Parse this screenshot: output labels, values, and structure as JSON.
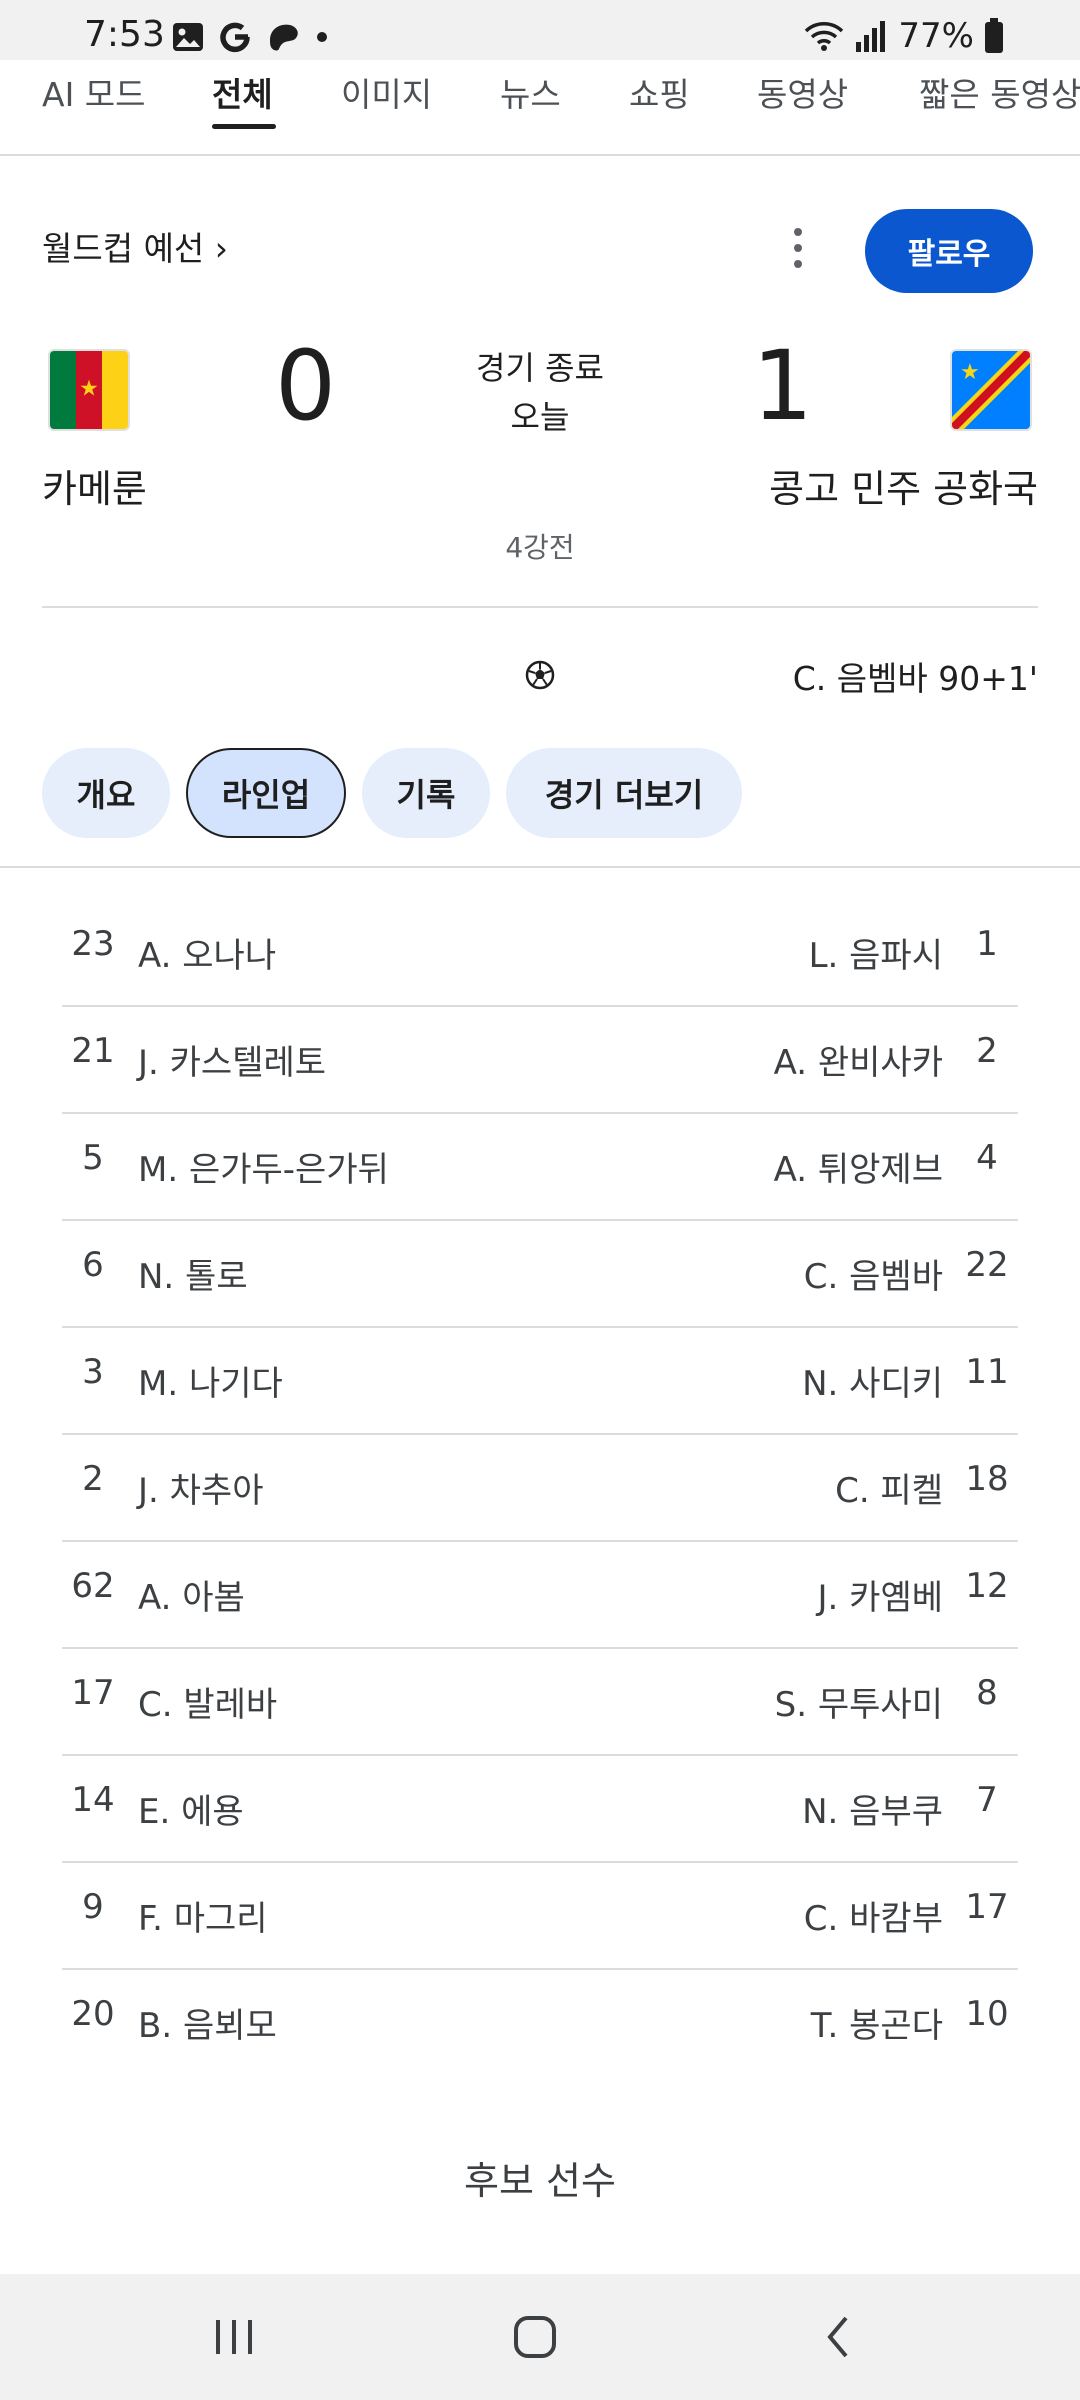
{
  "status_bar": {
    "time": "7:53",
    "battery": "77%",
    "icons_left": [
      "image-icon",
      "google-icon",
      "discover-icon",
      "dot-icon"
    ],
    "icons_right": [
      "wifi-icon",
      "signal-icon",
      "battery-icon"
    ]
  },
  "search_tabs": [
    "AI 모드",
    "전체",
    "이미지",
    "뉴스",
    "쇼핑",
    "동영상",
    "짧은 동영상"
  ],
  "active_tab": "전체",
  "header": {
    "competition": "월드컵 예선 ›",
    "follow_label": "팔로우"
  },
  "match": {
    "home": {
      "name": "카메룬",
      "score": "0",
      "flag": "cameroon-flag-icon"
    },
    "away": {
      "name": "콩고 민주 공화국",
      "score": "1",
      "flag": "dr-congo-flag-icon"
    },
    "status": "경기 종료",
    "date": "오늘",
    "round": "4강전",
    "goal": {
      "scorer": "C. 음벰바 90+1'",
      "team": "away"
    }
  },
  "chips": [
    "개요",
    "라인업",
    "기록",
    "경기 더보기"
  ],
  "active_chip": "라인업",
  "lineup": [
    {
      "home_num": "23",
      "home_name": "A. 오나나",
      "away_name": "L. 음파시",
      "away_num": "1"
    },
    {
      "home_num": "21",
      "home_name": "J. 카스텔레토",
      "away_name": "A. 완비사카",
      "away_num": "2"
    },
    {
      "home_num": "5",
      "home_name": "M. 은가두-은가뒤",
      "away_name": "A. 튀앙제브",
      "away_num": "4"
    },
    {
      "home_num": "6",
      "home_name": "N. 톨로",
      "away_name": "C. 음벰바",
      "away_num": "22"
    },
    {
      "home_num": "3",
      "home_name": "M. 나기다",
      "away_name": "N. 사디키",
      "away_num": "11"
    },
    {
      "home_num": "2",
      "home_name": "J. 차추아",
      "away_name": "C. 피켈",
      "away_num": "18"
    },
    {
      "home_num": "62",
      "home_name": "A. 아봄",
      "away_name": "J. 카옘베",
      "away_num": "12"
    },
    {
      "home_num": "17",
      "home_name": "C. 발레바",
      "away_name": "S. 무투사미",
      "away_num": "8"
    },
    {
      "home_num": "14",
      "home_name": "E. 에용",
      "away_name": "N. 음부쿠",
      "away_num": "7"
    },
    {
      "home_num": "9",
      "home_name": "F. 마그리",
      "away_name": "C. 바캄부",
      "away_num": "17"
    },
    {
      "home_num": "20",
      "home_name": "B. 음뵈모",
      "away_name": "T. 봉곤다",
      "away_num": "10"
    }
  ],
  "subs_title": "후보 선수",
  "nav_bar": [
    "recents-icon",
    "home-icon",
    "back-icon"
  ],
  "colors": {
    "accent": "#0b57d0",
    "chip": "#e6eefc",
    "chip_active": "#d3e3fd"
  }
}
